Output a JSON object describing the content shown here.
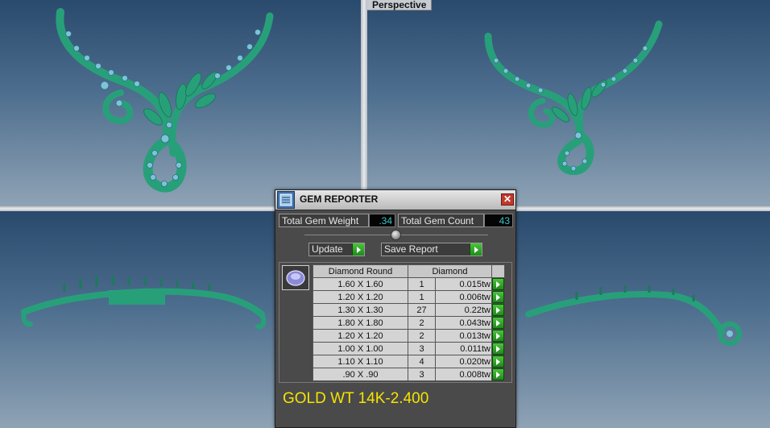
{
  "viewports": {
    "perspective_label": "Perspective"
  },
  "colors": {
    "model": "#27a07a",
    "model_highlight": "#5fd6ad",
    "gem": "#7ec3d8",
    "gold_text": "#f5e400",
    "value_text": "#38c6c9"
  },
  "gem_reporter": {
    "title": "GEM REPORTER",
    "close_icon": "close-icon",
    "total_weight_label": "Total Gem Weight",
    "total_weight_value": ".34",
    "total_count_label": "Total Gem Count",
    "total_count_value": "43",
    "update_label": "Update",
    "save_report_label": "Save Report",
    "table": {
      "headers": [
        "Diamond Round",
        "Diamond"
      ],
      "rows": [
        {
          "size": "1.60 X 1.60",
          "count": "1",
          "weight": "0.015tw"
        },
        {
          "size": "1.20 X 1.20",
          "count": "1",
          "weight": "0.006tw"
        },
        {
          "size": "1.30 X 1.30",
          "count": "27",
          "weight": "0.22tw"
        },
        {
          "size": "1.80 X 1.80",
          "count": "2",
          "weight": "0.043tw"
        },
        {
          "size": "1.20 X 1.20",
          "count": "2",
          "weight": "0.013tw"
        },
        {
          "size": "1.00 X 1.00",
          "count": "3",
          "weight": "0.011tw"
        },
        {
          "size": "1.10 X 1.10",
          "count": "4",
          "weight": "0.020tw"
        },
        {
          "size": ".90 X .90",
          "count": "3",
          "weight": "0.008tw"
        }
      ]
    },
    "gold_weight": "GOLD WT 14K-2.400"
  }
}
